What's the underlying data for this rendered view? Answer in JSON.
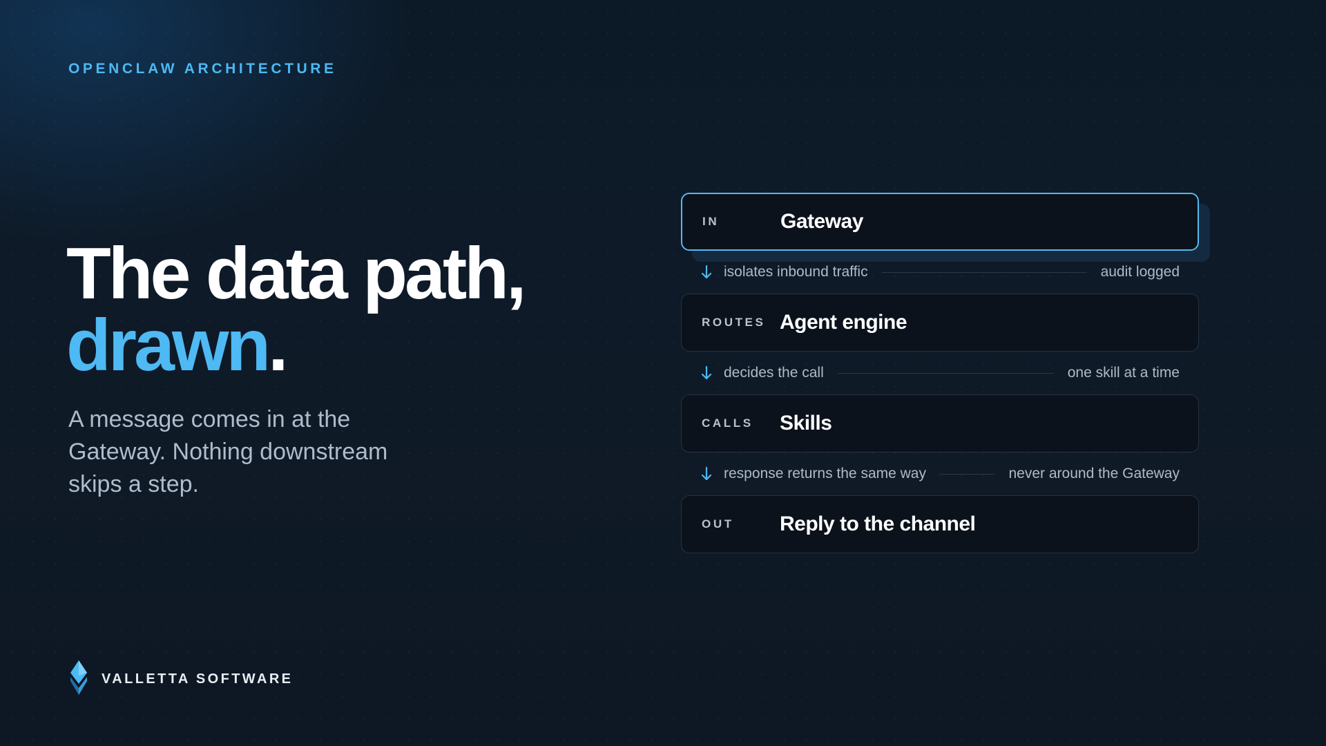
{
  "eyebrow": "OPENCLAW ARCHITECTURE",
  "headline": {
    "line1": "The data path,",
    "accent": "drawn",
    "period": "."
  },
  "lede": "A message comes in at the Gateway. Nothing downstream skips a step.",
  "brand": {
    "name": "VALLETTA SOFTWARE",
    "logo_icon": "diamond-logo-icon"
  },
  "colors": {
    "accent": "#4fb9f3",
    "background": "#0f1a27",
    "card": "#0b121b",
    "muted_text": "#aebccb"
  },
  "pipeline": {
    "stages": [
      {
        "tag": "IN",
        "title": "Gateway",
        "active": true
      },
      {
        "tag": "ROUTES",
        "title": "Agent engine",
        "active": false
      },
      {
        "tag": "CALLS",
        "title": "Skills",
        "active": false
      },
      {
        "tag": "OUT",
        "title": "Reply to the channel",
        "active": false
      }
    ],
    "links": [
      {
        "left": "isolates inbound traffic",
        "right": "audit logged",
        "icon": "arrow-down-icon"
      },
      {
        "left": "decides the call",
        "right": "one skill at a time",
        "icon": "arrow-down-icon"
      },
      {
        "left": "response returns the same way",
        "right": "never around the Gateway",
        "icon": "arrow-down-icon"
      }
    ]
  }
}
